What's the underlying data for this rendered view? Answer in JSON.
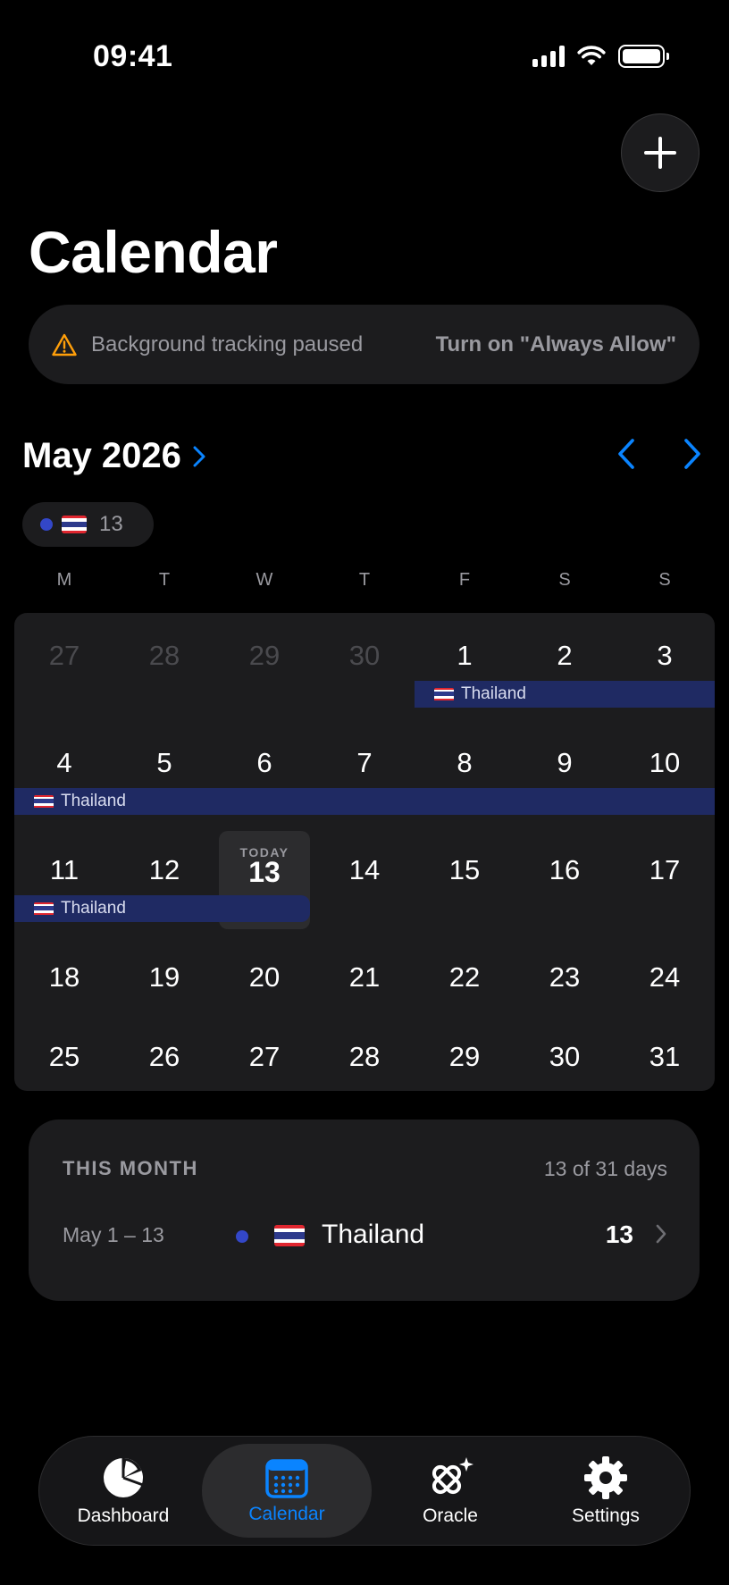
{
  "status_bar": {
    "time": "09:41"
  },
  "header": {
    "title": "Calendar",
    "add_label": "+"
  },
  "banner": {
    "text": "Background tracking paused",
    "action": "Turn on \"Always Allow\""
  },
  "month": {
    "title": "May 2026"
  },
  "chip": {
    "count": "13"
  },
  "weekdays": [
    "M",
    "T",
    "W",
    "T",
    "F",
    "S",
    "S"
  ],
  "weeks": [
    [
      "27",
      "28",
      "29",
      "30",
      "1",
      "2",
      "3"
    ],
    [
      "4",
      "5",
      "6",
      "7",
      "8",
      "9",
      "10"
    ],
    [
      "11",
      "12",
      "13",
      "14",
      "15",
      "16",
      "17"
    ],
    [
      "18",
      "19",
      "20",
      "21",
      "22",
      "23",
      "24"
    ],
    [
      "25",
      "26",
      "27",
      "28",
      "29",
      "30",
      "31"
    ]
  ],
  "stays": [
    {
      "label": "Thailand"
    },
    {
      "label": "Thailand"
    },
    {
      "label": "Thailand"
    }
  ],
  "today": {
    "label": "TODAY",
    "day": "13"
  },
  "this_month": {
    "title": "THIS MONTH",
    "summary": "13 of 31 days",
    "entry": {
      "range": "May 1 – 13",
      "country": "Thailand",
      "count": "13"
    }
  },
  "tabs": [
    {
      "label": "Dashboard"
    },
    {
      "label": "Calendar"
    },
    {
      "label": "Oracle"
    },
    {
      "label": "Settings"
    }
  ],
  "colors": {
    "accent": "#0a84ff",
    "stay_bar": "#1f2a63",
    "country_dot": "#3347c8",
    "warning": "#ff9f0a"
  }
}
